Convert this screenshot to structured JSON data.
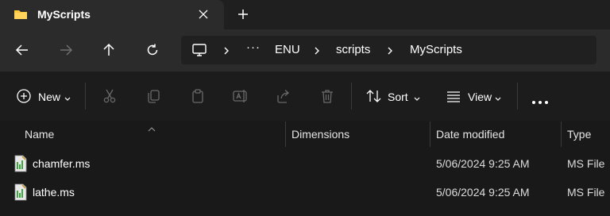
{
  "colors": {
    "accent": "#ffc83d",
    "window_bg": "#191919",
    "chrome_bg": "#2b2b2b"
  },
  "tab": {
    "title": "MyScripts",
    "icon": "folder-icon",
    "close_icon": "close-icon",
    "new_tab_icon": "plus-icon"
  },
  "nav": {
    "back_icon": "arrow-left-icon",
    "forward_icon": "arrow-right-icon",
    "up_icon": "arrow-up-icon",
    "refresh_icon": "refresh-icon"
  },
  "address": {
    "root_icon": "computer-icon",
    "overflow": "···",
    "crumbs": [
      "ENU",
      "scripts",
      "MyScripts"
    ]
  },
  "toolbar": {
    "new_label": "New",
    "sort_label": "Sort",
    "view_label": "View",
    "icons": [
      "cut-icon",
      "copy-icon",
      "paste-icon",
      "rename-icon",
      "share-icon",
      "delete-icon",
      "more-icon"
    ]
  },
  "columns": [
    "Name",
    "Dimensions",
    "Date modified",
    "Type"
  ],
  "files": [
    {
      "name": "chamfer.ms",
      "dimensions": "",
      "date": "5/06/2024 9:25 AM",
      "type": "MS File"
    },
    {
      "name": "lathe.ms",
      "dimensions": "",
      "date": "5/06/2024 9:25 AM",
      "type": "MS File"
    }
  ]
}
